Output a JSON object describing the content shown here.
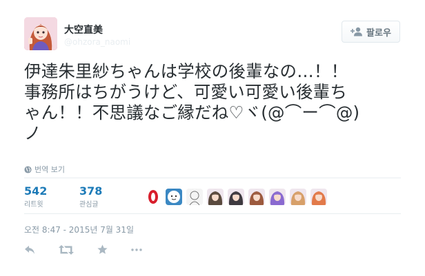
{
  "author": {
    "name": "大空直美",
    "handle": "@ohzora_naomi",
    "avatar_icon": "profile-avatar"
  },
  "follow_button": {
    "label": "팔로우",
    "icon": "add-user-icon"
  },
  "tweet": {
    "text": "伊達朱里紗ちゃんは学校の後輩なの…！！\n事務所はちがうけど、可愛い可愛い後輩ち\nゃん！！不思議なご縁だね♡ヾ(@⌒ー⌒@)\nノ"
  },
  "translate": {
    "label": "번역 보기",
    "icon": "globe-icon"
  },
  "stats": {
    "retweets": {
      "count": "542",
      "label": "리트윗"
    },
    "likes": {
      "count": "378",
      "label": "관심글"
    }
  },
  "liker_avatars": [
    {
      "name": "liker-avatar-red",
      "color": "#d81e2c"
    },
    {
      "name": "liker-avatar-face",
      "color": "#3b88c3"
    },
    {
      "name": "liker-avatar-sketch",
      "color": "#cfcfcf"
    },
    {
      "name": "liker-avatar-woman",
      "color": "#5a4a3e"
    },
    {
      "name": "liker-avatar-dark",
      "color": "#3e3a40"
    },
    {
      "name": "liker-avatar-anime1",
      "color": "#9c5a3e"
    },
    {
      "name": "liker-avatar-anime2",
      "color": "#8a6ad0"
    },
    {
      "name": "liker-avatar-anime3",
      "color": "#d7a06a"
    },
    {
      "name": "liker-avatar-anime4",
      "color": "#e27a4a"
    }
  ],
  "timestamp": "오전 8:47 - 2015년 7월 31일",
  "actions": {
    "reply_icon": "reply-icon",
    "retweet_icon": "retweet-icon",
    "like_icon": "star-icon",
    "more_icon": "more-icon"
  },
  "colors": {
    "link": "#1d7bb8",
    "muted": "#8899a6",
    "text": "#292f33",
    "divider": "#e8edf0"
  }
}
